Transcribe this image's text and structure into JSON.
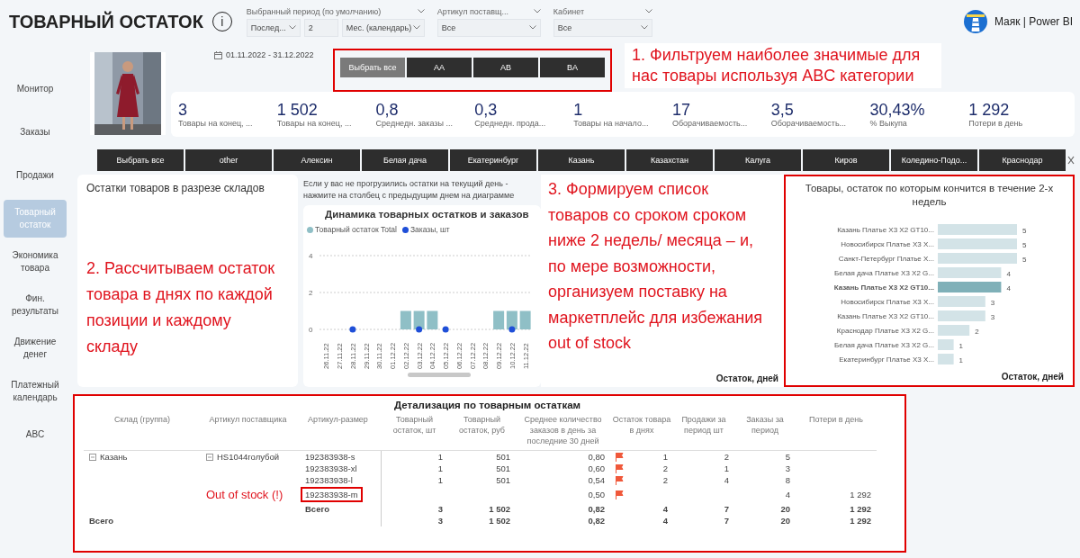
{
  "header": {
    "title": "ТОВАРНЫЙ ОСТАТОК",
    "info": "i",
    "brand": "Маяк | Power BI"
  },
  "filters": {
    "period": {
      "label": "Выбранный период (по умолчанию)",
      "mode": "Послед...",
      "count": "2",
      "unit": "Мес. (календарь)"
    },
    "article": {
      "label": "Артикул поставщ...",
      "value": "Все"
    },
    "cabinet": {
      "label": "Кабинет",
      "value": "Все"
    },
    "date_range": "01.11.2022 - 31.12.2022"
  },
  "sidebar": [
    {
      "label": "Монитор",
      "selected": false
    },
    {
      "label": "Заказы",
      "selected": false
    },
    {
      "label": "Продажи",
      "selected": false
    },
    {
      "label": "Товарный остаток",
      "selected": true
    },
    {
      "label": "Экономика товара",
      "selected": false
    },
    {
      "label": "Фин. результаты",
      "selected": false
    },
    {
      "label": "Движение денег",
      "selected": false
    },
    {
      "label": "Платежный календарь",
      "selected": false
    },
    {
      "label": "ABC",
      "selected": false
    }
  ],
  "abc_slicer": [
    {
      "label": "Выбрать все",
      "selected": true
    },
    {
      "label": "AA",
      "selected": false
    },
    {
      "label": "AB",
      "selected": false
    },
    {
      "label": "BA",
      "selected": false
    }
  ],
  "annotations": [
    "1. Фильтруем наиболее значимые для нас товары используя ABC категории",
    "2. Рассчитываем остаток товара в днях по каждой позиции и каждому складу",
    "3. Формируем список товаров со сроком сроком ниже 2 недель/ месяца – и, по мере возможности, организуем поставку на маркетплейс для избежания out of stock"
  ],
  "kpis": [
    {
      "value": "3",
      "label": "Товары на конец, ..."
    },
    {
      "value": "1 502",
      "label": "Товары на конец, ..."
    },
    {
      "value": "0,8",
      "label": "Среднедн. заказы ..."
    },
    {
      "value": "0,3",
      "label": "Среднедн. прода..."
    },
    {
      "value": "1",
      "label": "Товары на начало..."
    },
    {
      "value": "17",
      "label": "Оборачиваемость..."
    },
    {
      "value": "3,5",
      "label": "Оборачиваемость..."
    },
    {
      "value": "30,43%",
      "label": "% Выкупа"
    },
    {
      "value": "1 292",
      "label": "Потери в день"
    }
  ],
  "warehouse_slicer": [
    {
      "label": "Выбрать все",
      "selected": false
    },
    {
      "label": "other",
      "selected": false
    },
    {
      "label": "Алексин",
      "selected": false
    },
    {
      "label": "Белая дача",
      "selected": false
    },
    {
      "label": "Екатеринбург",
      "selected": false
    },
    {
      "label": "Казань",
      "selected": false
    },
    {
      "label": "Казахстан",
      "selected": false
    },
    {
      "label": "Калуга",
      "selected": false
    },
    {
      "label": "Киров",
      "selected": false
    },
    {
      "label": "Коледино-Подо...",
      "selected": false
    },
    {
      "label": "Краснодар",
      "selected": false
    }
  ],
  "stock_panel": {
    "title": "Остатки товаров в разрезе складов"
  },
  "dynamics": {
    "hint": [
      "Если у вас не прогрузились остатки на текущий день -",
      "нажмите на столбец с предыдущим днем на диаграмме"
    ],
    "title": "Динамика товарных остатков и заказов",
    "chart_data": {
      "type": "bar",
      "categories": [
        "26.11.22",
        "27.11.22",
        "28.11.22",
        "29.11.22",
        "30.11.22",
        "01.12.22",
        "02.12.22",
        "03.12.22",
        "04.12.22",
        "05.12.22",
        "06.12.22",
        "07.12.22",
        "08.12.22",
        "09.12.22",
        "10.12.22",
        "11.12.22"
      ],
      "ylim": [
        0,
        4
      ],
      "yticks": [
        0,
        2,
        4
      ],
      "series": [
        {
          "name": "Товарный остаток Total",
          "color": "#8fbfc6",
          "values": [
            null,
            null,
            null,
            null,
            null,
            null,
            1,
            1,
            1,
            null,
            null,
            null,
            null,
            1,
            1,
            1
          ]
        },
        {
          "name": "Заказы, шт",
          "color": "#1f4fd8",
          "values": [
            null,
            null,
            0,
            null,
            null,
            null,
            null,
            0,
            null,
            0,
            null,
            null,
            null,
            null,
            0,
            null
          ]
        }
      ]
    }
  },
  "halfyear_panel": {
    "axis_label": "Остаток, дней"
  },
  "ending_panel": {
    "title": "Товары, остаток по которым кончится в течение 2-х недель",
    "axis_label": "Остаток, дней",
    "selected": [
      false,
      false,
      false,
      false,
      true,
      false,
      false,
      false,
      false,
      false
    ],
    "chart_data": {
      "type": "bar",
      "orientation": "horizontal",
      "data_labels": true,
      "categories": [
        "Казань Платье X3 X2 GT10...",
        "Новосибирск Платье X3 X...",
        "Санкт-Петербург Платье X...",
        "Белая дача Платье X3 X2 G...",
        "Казань Платье X3 X2 GT10...",
        "Новосибирск Платье X3 X...",
        "Казань Платье X3 X2 GT10...",
        "Краснодар Платье X3 X2 G...",
        "Белая дача Платье X3 X2 G...",
        "Екатеринбург Платье X3 X..."
      ],
      "values": [
        5,
        5,
        5,
        4,
        4,
        3,
        3,
        2,
        1,
        1
      ]
    }
  },
  "detail_table": {
    "title": "Детализация по товарным остаткам",
    "columns": [
      "Склад (группа)",
      "Артикул поставщика",
      "Артикул-размер",
      "Товарный остаток, шт",
      "Товарный остаток, руб",
      "Среднее количество заказов в день за последние 30 дней",
      "Остаток товара в днях",
      "Продажи за период шт",
      "Заказы за период",
      "Потери в день"
    ],
    "rows": [
      {
        "kind": "item",
        "group": "Казань",
        "group_expanded": true,
        "article": "HS1044голубой",
        "article_expanded": true,
        "size": "192383938-s",
        "qty": "1",
        "rub": "501",
        "avg": "0,80",
        "flagged": true,
        "days": "1",
        "sales": "2",
        "orders": "5"
      },
      {
        "kind": "item",
        "size": "192383938-xl",
        "qty": "1",
        "rub": "501",
        "avg": "0,60",
        "flagged": true,
        "days": "2",
        "sales": "1",
        "orders": "3"
      },
      {
        "kind": "item",
        "size": "192383938-l",
        "qty": "1",
        "rub": "501",
        "avg": "0,54",
        "flagged": true,
        "days": "2",
        "sales": "4",
        "orders": "8"
      },
      {
        "kind": "item",
        "size": "192383938-m",
        "highlighted": true,
        "note": "Out of stock (!)",
        "avg": "0,50",
        "flagged": true,
        "orders": "4",
        "loss": "1 292"
      },
      {
        "kind": "subtotal",
        "size": "Всего",
        "qty": "3",
        "rub": "1 502",
        "avg": "0,82",
        "days": "4",
        "sales": "7",
        "orders": "20",
        "loss": "1 292"
      },
      {
        "kind": "total",
        "group": "Всего",
        "qty": "3",
        "rub": "1 502",
        "avg": "0,82",
        "days": "4",
        "sales": "7",
        "orders": "20",
        "loss": "1 292"
      }
    ]
  }
}
